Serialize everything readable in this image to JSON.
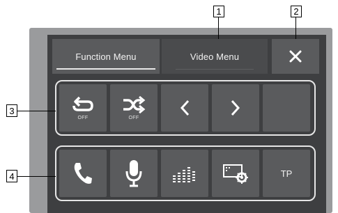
{
  "tabs": {
    "function_menu": "Function Menu",
    "video_menu": "Video Menu"
  },
  "close_symbol": "✕",
  "controls_row": [
    {
      "icon": "repeat-icon",
      "sub_label": "OFF"
    },
    {
      "icon": "shuffle-icon",
      "sub_label": "OFF"
    },
    {
      "icon": "chevron-left-icon",
      "label": "‹"
    },
    {
      "icon": "chevron-right-icon",
      "label": "›"
    },
    {
      "icon": "empty-button"
    }
  ],
  "shortcuts_row": [
    {
      "icon": "phone-icon"
    },
    {
      "icon": "microphone-icon"
    },
    {
      "icon": "equalizer-icon"
    },
    {
      "icon": "display-settings-icon"
    },
    {
      "icon": "tp-button",
      "label": "TP"
    }
  ],
  "callouts": {
    "c1": "1",
    "c2": "2",
    "c3": "3",
    "c4": "4"
  },
  "colors": {
    "bezel": "#9a9b9d",
    "panel": "#3e3f41",
    "button": "#5a5b5d",
    "outline": "#e6e6e6"
  }
}
